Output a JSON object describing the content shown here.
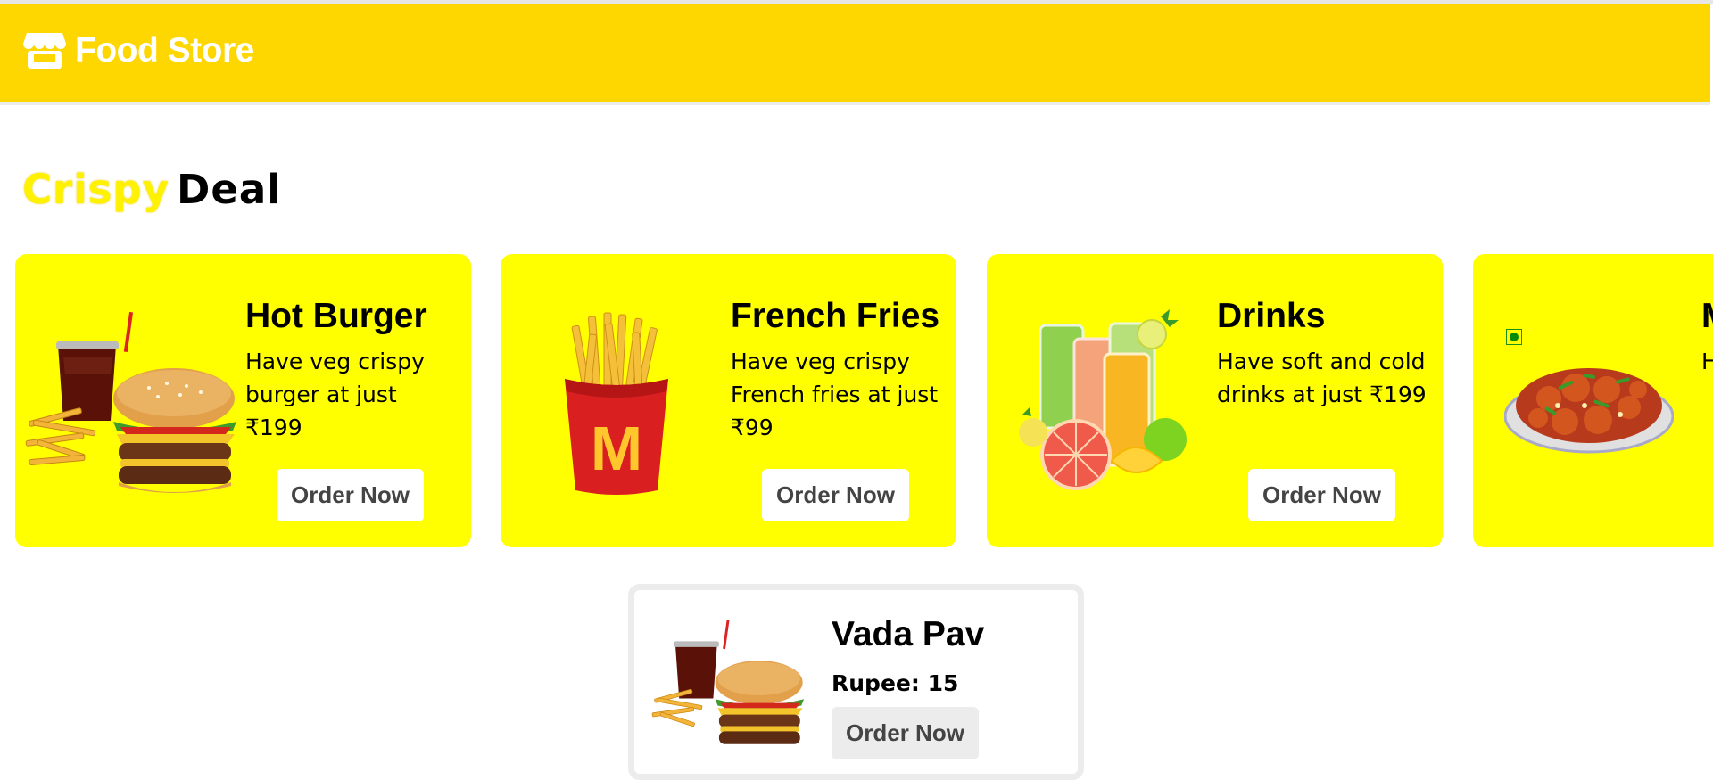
{
  "navbar": {
    "brand": "Food Store",
    "brand_icon": "store-icon",
    "color": "#FFD700"
  },
  "section": {
    "title_part1": "Crispy",
    "title_part2": "Deal"
  },
  "cards": [
    {
      "title": "Hot Burger",
      "description": "Have veg crispy burger at just ₹199",
      "button": "Order Now",
      "image": "burger-combo-image"
    },
    {
      "title": "French Fries",
      "description": "Have veg crispy French fries at just ₹99",
      "button": "Order Now",
      "image": "french-fries-image"
    },
    {
      "title": "Drinks",
      "description": "Have soft and cold drinks at just ₹199",
      "button": "Order Now",
      "image": "juice-drinks-image"
    },
    {
      "title": "M",
      "description": "H n ₹",
      "image": "chilli-chicken-image",
      "selected": true
    }
  ],
  "featured": {
    "title": "Vada Pav",
    "price_label": "Rupee:",
    "price_value": "15",
    "button": "Order Now",
    "image": "burger-combo-image"
  },
  "colors": {
    "card_background": "#FFFF00",
    "accent_yellow": "#FFF200",
    "button_text": "#444444",
    "featured_border": "#ECECEC"
  }
}
